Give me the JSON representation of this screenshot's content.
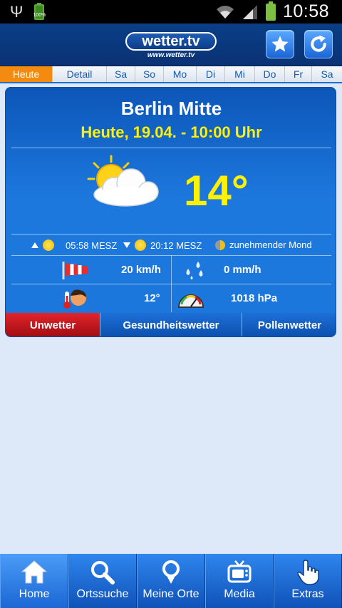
{
  "status_bar": {
    "battery_small_label": "100%",
    "time": "10:58"
  },
  "header": {
    "logo_text": "wetter.tv",
    "logo_url_text": "www.wetter.tv",
    "icons": [
      "star-icon",
      "refresh-icon"
    ]
  },
  "tabs": [
    "Heute",
    "Detail",
    "Sa",
    "So",
    "Mo",
    "Di",
    "Mi",
    "Do",
    "Fr",
    "Sa"
  ],
  "active_tab": "Heute",
  "weather": {
    "city": "Berlin Mitte",
    "datetime": "Heute, 19.04. - 10:00 Uhr",
    "condition_icon": "partly-cloudy-icon",
    "temperature": "14°",
    "sunrise": "05:58 MESZ",
    "sunset": "20:12 MESZ",
    "moon": "zunehmender Mond",
    "wind": "20 km/h",
    "precipitation": "0 mm/h",
    "feels_like": "12°",
    "pressure": "1018 hPa"
  },
  "card_tabs": [
    "Unwetter",
    "Gesundheitswetter",
    "Pollenwetter"
  ],
  "bottom_nav": [
    "Home",
    "Ortssuche",
    "Meine Orte",
    "Media",
    "Extras"
  ],
  "colors": {
    "accent_orange": "#f38b10",
    "header_blue": "#0a3e86",
    "temperature_yellow": "#fff200",
    "warning_red": "#e3242b"
  }
}
